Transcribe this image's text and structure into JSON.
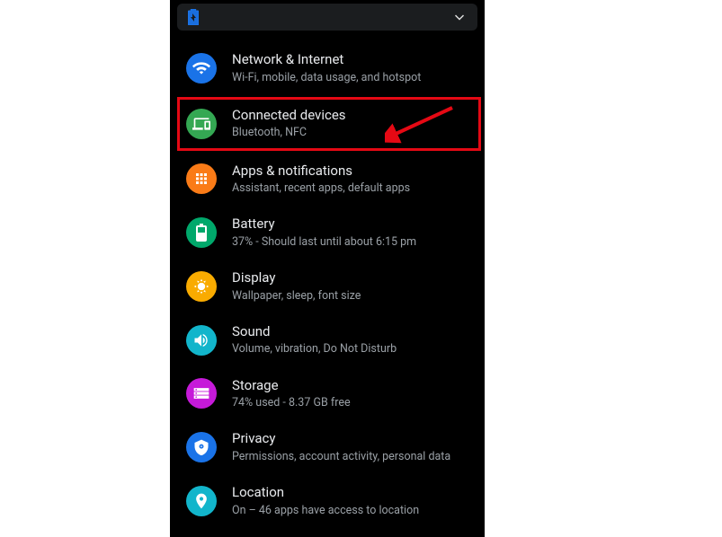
{
  "settings": {
    "items": [
      {
        "title": "Network & Internet",
        "subtitle": "Wi-Fi, mobile, data usage, and hotspot"
      },
      {
        "title": "Connected devices",
        "subtitle": "Bluetooth, NFC"
      },
      {
        "title": "Apps & notifications",
        "subtitle": "Assistant, recent apps, default apps"
      },
      {
        "title": "Battery",
        "subtitle": "37% - Should last until about 6:15 pm"
      },
      {
        "title": "Display",
        "subtitle": "Wallpaper, sleep, font size"
      },
      {
        "title": "Sound",
        "subtitle": "Volume, vibration, Do Not Disturb"
      },
      {
        "title": "Storage",
        "subtitle": "74% used - 8.37 GB free"
      },
      {
        "title": "Privacy",
        "subtitle": "Permissions, account activity, personal data"
      },
      {
        "title": "Location",
        "subtitle": "On – 46 apps have access to location"
      }
    ]
  }
}
